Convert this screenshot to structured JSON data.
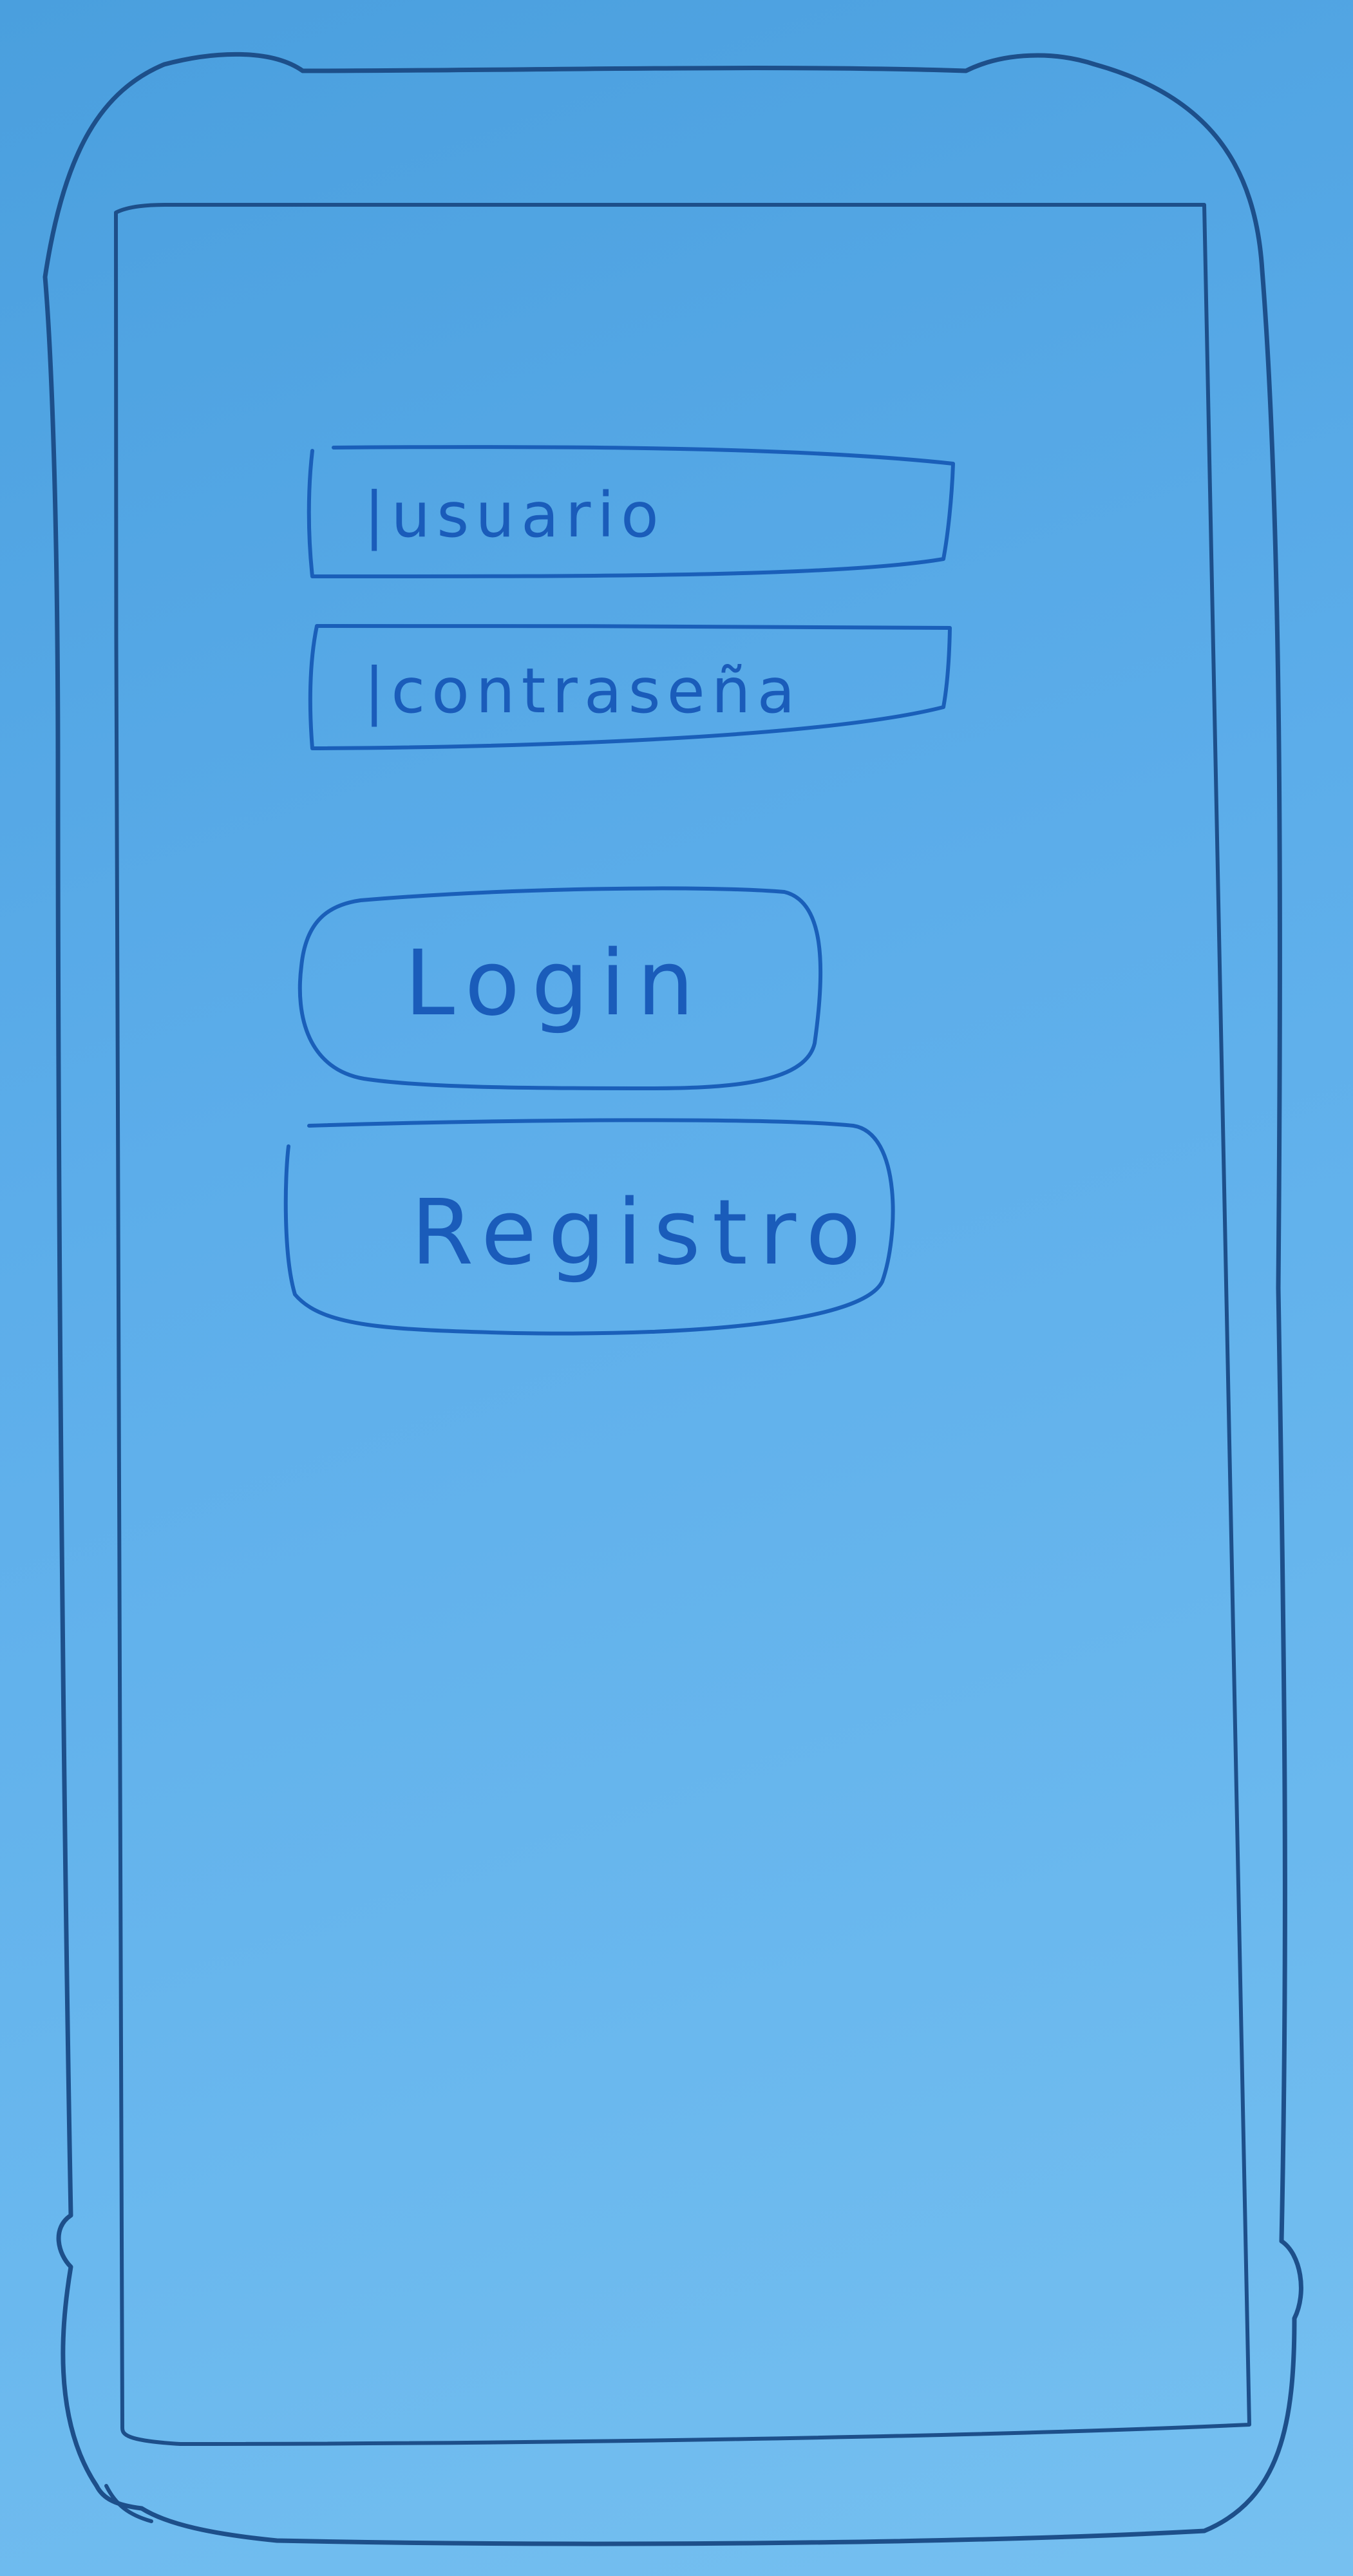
{
  "app": {
    "screen": "login"
  },
  "form": {
    "username_placeholder": "usuario",
    "password_placeholder": "contraseña",
    "caret": "|"
  },
  "buttons": {
    "login_label": "Login",
    "register_label": "Registro"
  },
  "colors": {
    "paper": "#5cadea",
    "frame_ink": "#1d4f8a",
    "pen_ink": "#1a5fb9"
  }
}
